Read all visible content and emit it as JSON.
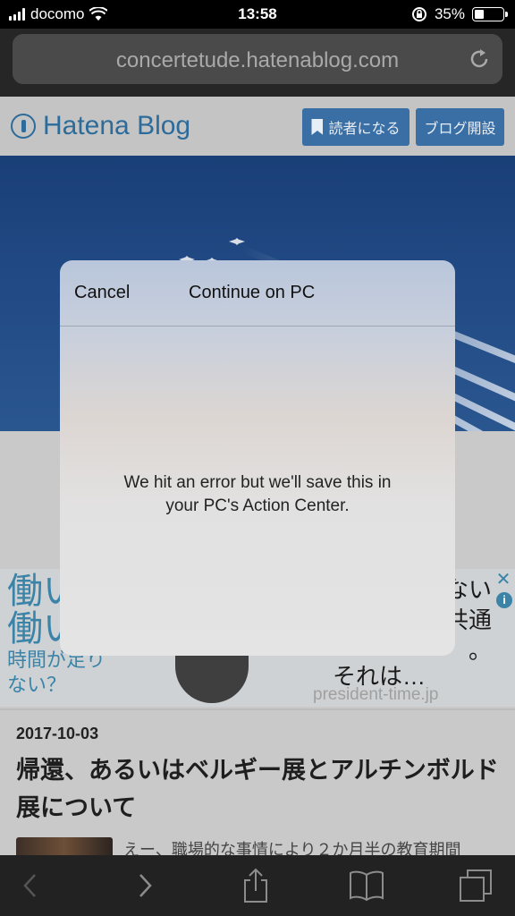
{
  "status_bar": {
    "carrier": "docomo",
    "time": "13:58",
    "battery_percent": "35%",
    "battery_level": 0.35
  },
  "browser": {
    "url": "concertetude.hatenablog.com"
  },
  "page": {
    "header": {
      "logo_text": "Hatena Blog",
      "reader_button": "読者になる",
      "blog_button": "ブログ開設"
    },
    "ad": {
      "left_big_1": "働い",
      "left_big_2": "働い",
      "left_small_1": "時間が足り",
      "left_small_2": "ない？",
      "right_line_1": "ない",
      "right_line_2": "共通",
      "right_line_3": "。",
      "tagline": "それは…",
      "domain": "president-time.jp",
      "close_glyph": "✕",
      "info_glyph": "i"
    },
    "post": {
      "date": "2017-10-03",
      "title": "帰還、あるいはベルギー展とアルチンボルド展について",
      "excerpt": "えー、職場的な事情により２か月半の教育期間"
    }
  },
  "modal": {
    "cancel": "Cancel",
    "title": "Continue on PC",
    "message_line_1": "We hit an error but we'll save this in",
    "message_line_2": "your PC's Action Center."
  }
}
